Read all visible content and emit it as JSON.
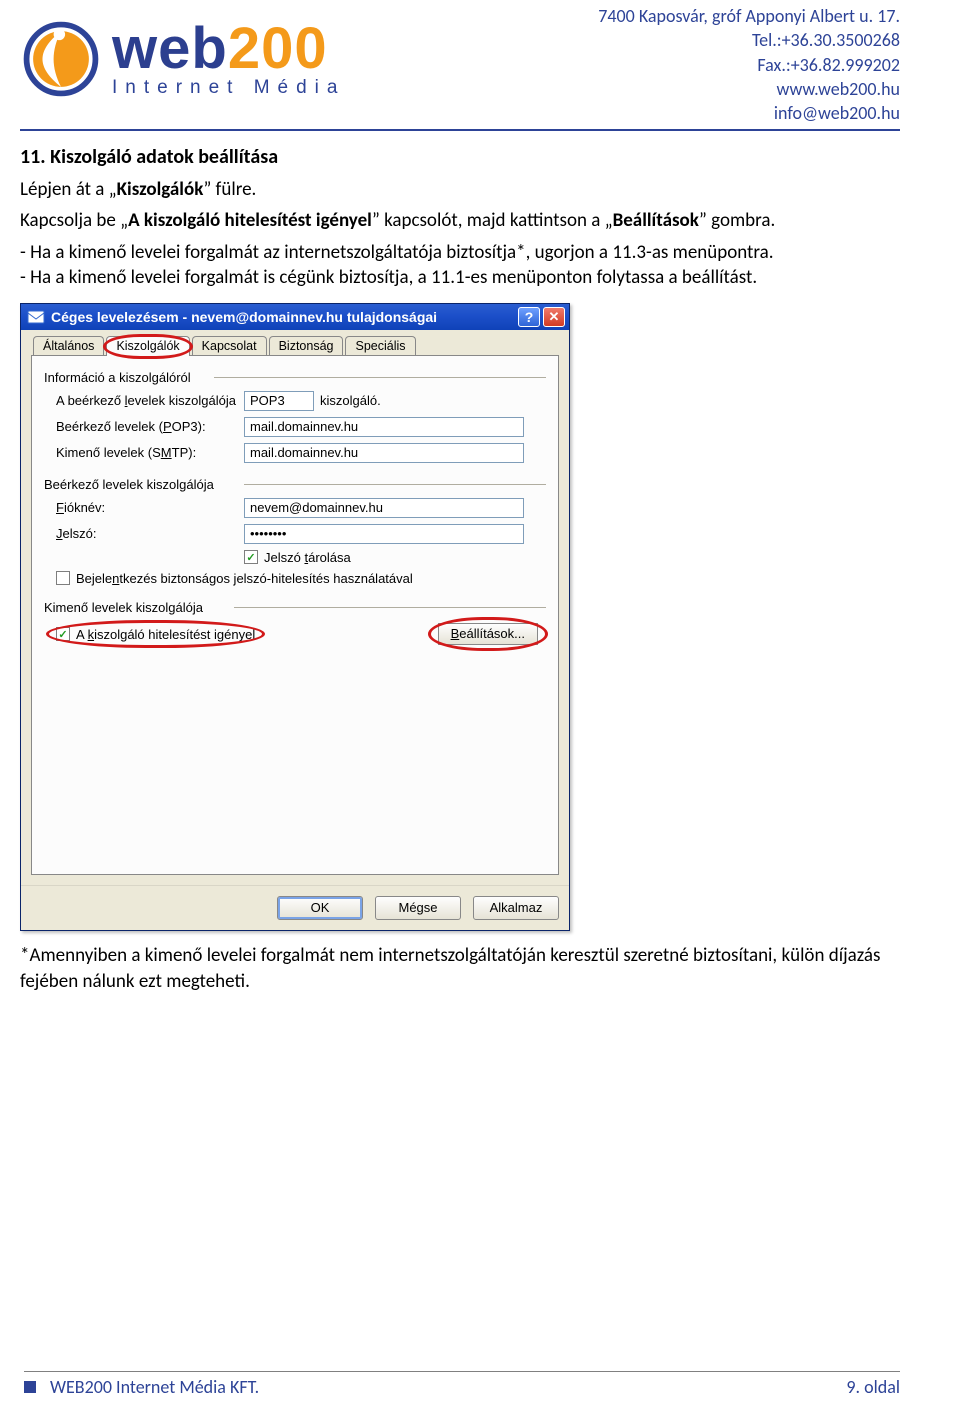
{
  "contact": {
    "line1": "7400 Kaposvár, gróf Apponyi Albert u. 17.",
    "line2": "Tel.:+36.30.3500268",
    "line3": "Fax.:+36.82.999202",
    "line4": "www.web200.hu",
    "line5": "info@web200.hu"
  },
  "logo": {
    "web": "web",
    "num": "200",
    "sub": "Internet Média"
  },
  "section": {
    "number_title": "11.  Kiszolgáló adatok beállítása",
    "line1_pre": "Lépjen át a „",
    "line1_bold": "Kiszolgálók",
    "line1_post": "” fülre.",
    "line2_pre": "Kapcsolja be „",
    "line2_bold1": "A kiszolgáló hitelesítést igényel",
    "line2_mid": "” kapcsolót, majd kattintson a „",
    "line2_bold2": "Beállítások",
    "line2_post": "” gombra.",
    "bullet1": "- Ha a kimenő levelei forgalmát az internetszolgáltatója biztosítja*, ugorjon a 11.3-as menüpontra.",
    "bullet2": "- Ha a kimenő levelei forgalmát is cégünk biztosítja, a 11.1-es menüponton folytassa a beállítást.",
    "footnote": "*Amennyiben a kimenő levelei forgalmát nem internetszolgáltatóján keresztül szeretné biztosítani, külön díjazás fejében nálunk ezt megteheti."
  },
  "dialog": {
    "title": "Céges levelezésem - nevem@domainnev.hu tulajdonságai",
    "tabs": {
      "t0": "Általános",
      "t1": "Kiszolgálók",
      "t2": "Kapcsolat",
      "t3": "Biztonság",
      "t4": "Speciális"
    },
    "group1": "Információ a kiszolgálóról",
    "row1_label_pre": "A beérkező ",
    "row1_label_ul": "l",
    "row1_label_post": "evelek kiszolgálója",
    "row1_value": "POP3",
    "row1_suffix": "kiszolgáló.",
    "row2_label_pre": "Beérkező levelek (",
    "row2_label_ul": "P",
    "row2_label_post": "OP3):",
    "row2_value": "mail.domainnev.hu",
    "row3_label_pre": "Kimenő levelek (S",
    "row3_label_ul": "M",
    "row3_label_post": "TP):",
    "row3_value": "mail.domainnev.hu",
    "group2": "Beérkező levelek kiszolgálója",
    "row4_label_ul": "F",
    "row4_label_post": "ióknév:",
    "row4_value": "nevem@domainnev.hu",
    "row5_label_ul": "J",
    "row5_label_post": "elszó:",
    "row5_value": "••••••••",
    "chk1_pre": "Jelszó ",
    "chk1_ul": "t",
    "chk1_post": "árolása",
    "chk2_pre": "Bejele",
    "chk2_ul": "n",
    "chk2_post": "tkezés biztonságos jelszó-hitelesítés használatával",
    "group3": "Kimenő levelek kiszolgálója",
    "chk3_pre": "A ",
    "chk3_ul": "k",
    "chk3_post": "iszolgáló hitelesítést igényel",
    "settings_btn_ul": "B",
    "settings_btn_post": "eállítások...",
    "buttons": {
      "ok": "OK",
      "cancel": "Mégse",
      "apply": "Alkalmaz"
    }
  },
  "footer": {
    "company": "WEB200 Internet Média KFT.",
    "page": "9. oldal"
  }
}
